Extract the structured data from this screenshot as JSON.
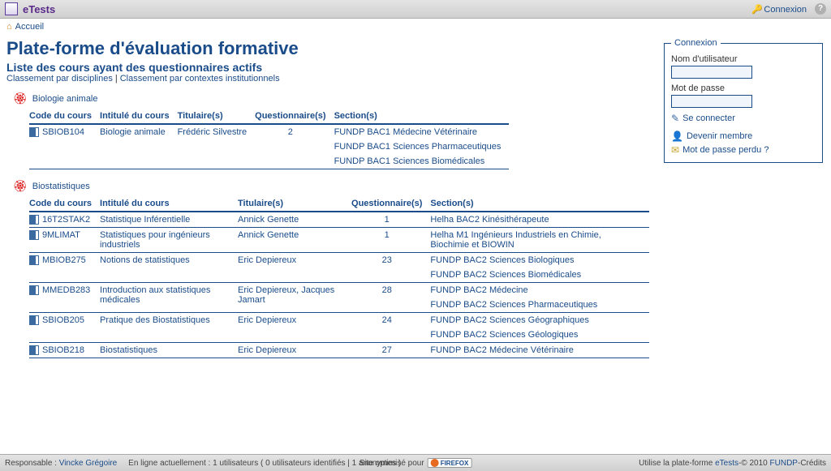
{
  "topbar": {
    "title": "eTests",
    "connexion": "Connexion"
  },
  "crumb": "Accueil",
  "h1": "Plate-forme d'évaluation formative",
  "h2": "Liste des cours ayant des questionnaires actifs",
  "ranking": {
    "by_disc": "Classement par disciplines",
    "by_ctx": "Classement par contextes institutionnels"
  },
  "cols": {
    "code": "Code du cours",
    "title": "Intitulé du cours",
    "owner": "Titulaire(s)",
    "q": "Questionnaire(s)",
    "sec": "Section(s)"
  },
  "disciplines": [
    {
      "name": "Biologie animale",
      "rows": [
        {
          "code": "SBIOB104",
          "title": "Biologie animale",
          "owner": "Frédéric Silvestre",
          "q": "2",
          "sections": [
            "FUNDP BAC1 Médecine Vétérinaire",
            "FUNDP BAC1 Sciences Pharmaceutiques",
            "FUNDP BAC1 Sciences Biomédicales"
          ]
        }
      ]
    },
    {
      "name": "Biostatistiques",
      "rows": [
        {
          "code": "16T2STAK2",
          "title": "Statistique Inférentielle",
          "owner": "Annick Genette",
          "q": "1",
          "sections": [
            "Helha BAC2 Kinésithérapeute"
          ]
        },
        {
          "code": "9MLIMAT",
          "title": "Statistiques pour ingénieurs industriels",
          "owner": "Annick Genette",
          "q": "1",
          "sections": [
            "Helha M1 Ingénieurs Industriels en Chimie, Biochimie et BIOWIN"
          ]
        },
        {
          "code": "MBIOB275",
          "title": "Notions de statistiques",
          "owner": "Eric Depiereux",
          "q": "23",
          "sections": [
            "FUNDP BAC2 Sciences Biologiques",
            "FUNDP BAC2 Sciences Biomédicales"
          ]
        },
        {
          "code": "MMEDB283",
          "title": "Introduction aux statistiques médicales",
          "owner": "Eric Depiereux, Jacques Jamart",
          "q": "28",
          "sections": [
            "FUNDP BAC2 Médecine",
            "FUNDP BAC2 Sciences Pharmaceutiques"
          ]
        },
        {
          "code": "SBIOB205",
          "title": "Pratique des Biostatistiques",
          "owner": "Eric Depiereux",
          "q": "24",
          "sections": [
            "FUNDP BAC2 Sciences Géographiques",
            "FUNDP BAC2 Sciences Géologiques"
          ]
        },
        {
          "code": "SBIOB218",
          "title": "Biostatistiques",
          "owner": "Eric Depiereux",
          "q": "27",
          "sections": [
            "FUNDP BAC2 Médecine Vétérinaire"
          ]
        }
      ]
    }
  ],
  "login": {
    "legend": "Connexion",
    "user": "Nom d'utilisateur",
    "pass": "Mot de passe",
    "btn": "Se connecter",
    "register": "Devenir membre",
    "forgot": "Mot de passe perdu ?"
  },
  "footer": {
    "resp_lbl": "Responsable :",
    "resp": "Vincke Grégoire",
    "online": "En ligne actuellement : 1 utilisateurs ( 0 utilisateurs identifiés | 1 anonymes )",
    "optim": "Site optimisé pour",
    "firefox": "FIREFOX",
    "uses": "Utilise la plate-forme",
    "etests": "eTests",
    "copy": "-© 2010",
    "fundp": "FUNDP",
    "credits": "-Crédits"
  }
}
